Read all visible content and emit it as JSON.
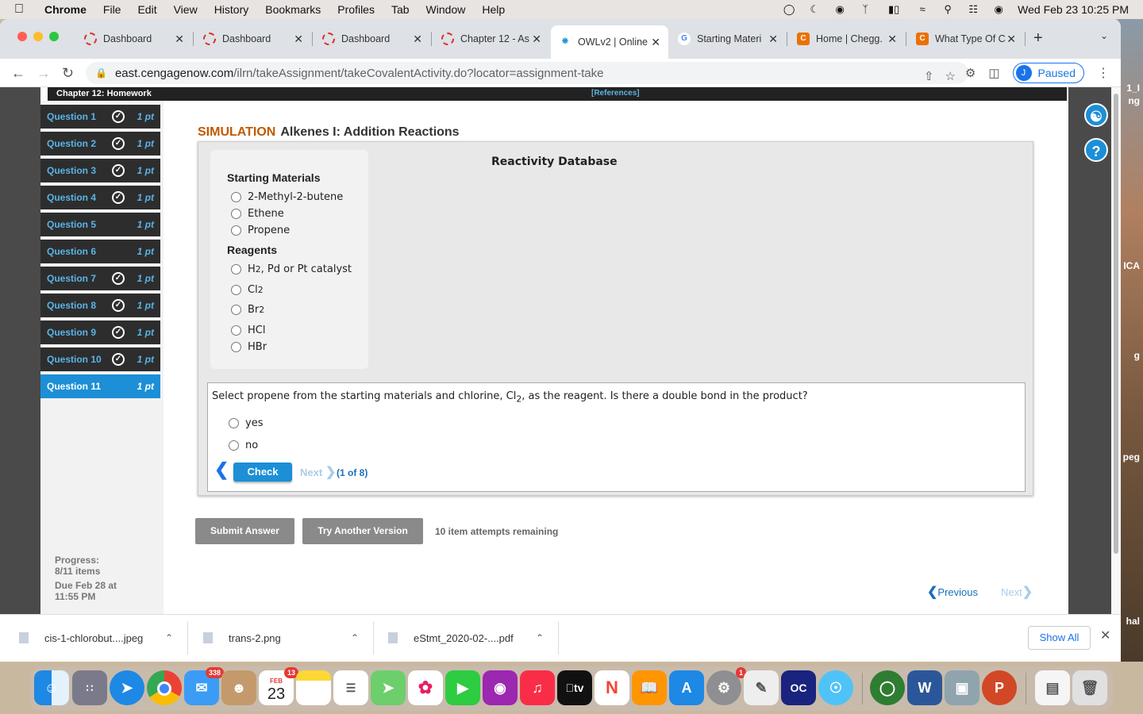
{
  "menubar": {
    "app": "Chrome",
    "items": [
      "File",
      "Edit",
      "View",
      "History",
      "Bookmarks",
      "Profiles",
      "Tab",
      "Window",
      "Help"
    ],
    "datetime": "Wed Feb 23  10:25 PM"
  },
  "tabs": [
    {
      "label": "Dashboard"
    },
    {
      "label": "Dashboard"
    },
    {
      "label": "Dashboard"
    },
    {
      "label": "Chapter 12 - As"
    },
    {
      "label": "OWLv2 | Online"
    },
    {
      "label": "Starting Materi"
    },
    {
      "label": "Home | Chegg."
    },
    {
      "label": "What Type Of C"
    }
  ],
  "address": {
    "host": "east.cengagenow.com",
    "path": "/ilrn/takeAssignment/takeCovalentActivity.do?locator=assignment-take"
  },
  "profile": {
    "initial": "J",
    "status": "Paused"
  },
  "assignment": {
    "chapter": "Chapter 12: Homework",
    "references": "[References]",
    "questions": [
      {
        "label": "Question 1",
        "pts": "1 pt"
      },
      {
        "label": "Question 2",
        "pts": "1 pt"
      },
      {
        "label": "Question 3",
        "pts": "1 pt"
      },
      {
        "label": "Question 4",
        "pts": "1 pt"
      },
      {
        "label": "Question 5",
        "pts": "1 pt"
      },
      {
        "label": "Question 6",
        "pts": "1 pt"
      },
      {
        "label": "Question 7",
        "pts": "1 pt"
      },
      {
        "label": "Question 8",
        "pts": "1 pt"
      },
      {
        "label": "Question 9",
        "pts": "1 pt"
      },
      {
        "label": "Question 10",
        "pts": "1 pt"
      },
      {
        "label": "Question 11",
        "pts": "1 pt"
      }
    ],
    "progress_label": "Progress:",
    "progress_value": "8/11 items",
    "due_label": "Due Feb 28 at",
    "due_time": "11:55 PM"
  },
  "simulation": {
    "tag": "SIMULATION",
    "title": "Alkenes I: Addition Reactions",
    "db_title": "Reactivity Database",
    "starting_header": "Starting Materials",
    "starting": [
      "2-Methyl-2-butene",
      "Ethene",
      "Propene"
    ],
    "reagents_header": "Reagents",
    "reagents": [
      {
        "base": "H",
        "sub": "2",
        "rest": ", Pd or Pt catalyst"
      },
      {
        "base": "Cl",
        "sub": "2",
        "rest": ""
      },
      {
        "base": "Br",
        "sub": "2",
        "rest": ""
      },
      {
        "base": "HCl",
        "sub": "",
        "rest": ""
      },
      {
        "base": "HBr",
        "sub": "",
        "rest": ""
      }
    ],
    "question_pre": "Select propene from the starting materials and chlorine, Cl",
    "question_sub": "2",
    "question_post": ", as the reagent. Is there a double bond in the product?",
    "answers": [
      "yes",
      "no"
    ],
    "check_label": "Check",
    "next_label": "Next",
    "step": "(1 of 8)"
  },
  "actions": {
    "submit": "Submit Answer",
    "try_another": "Try Another Version",
    "attempts": "10 item attempts remaining",
    "previous": "Previous",
    "next": "Next"
  },
  "downloads": {
    "files": [
      "cis-1-chlorobut....jpeg",
      "trans-2.png",
      "eStmt_2020-02-....pdf"
    ],
    "show_all": "Show All"
  },
  "dock": {
    "mail_badge": "338",
    "calendar_month": "FEB",
    "calendar_day": "23",
    "calendar_badge": "13",
    "settings_badge": "1"
  },
  "wallpaper_text": [
    "1_I",
    "ng",
    "ICA",
    "g",
    "peg",
    "hal"
  ]
}
